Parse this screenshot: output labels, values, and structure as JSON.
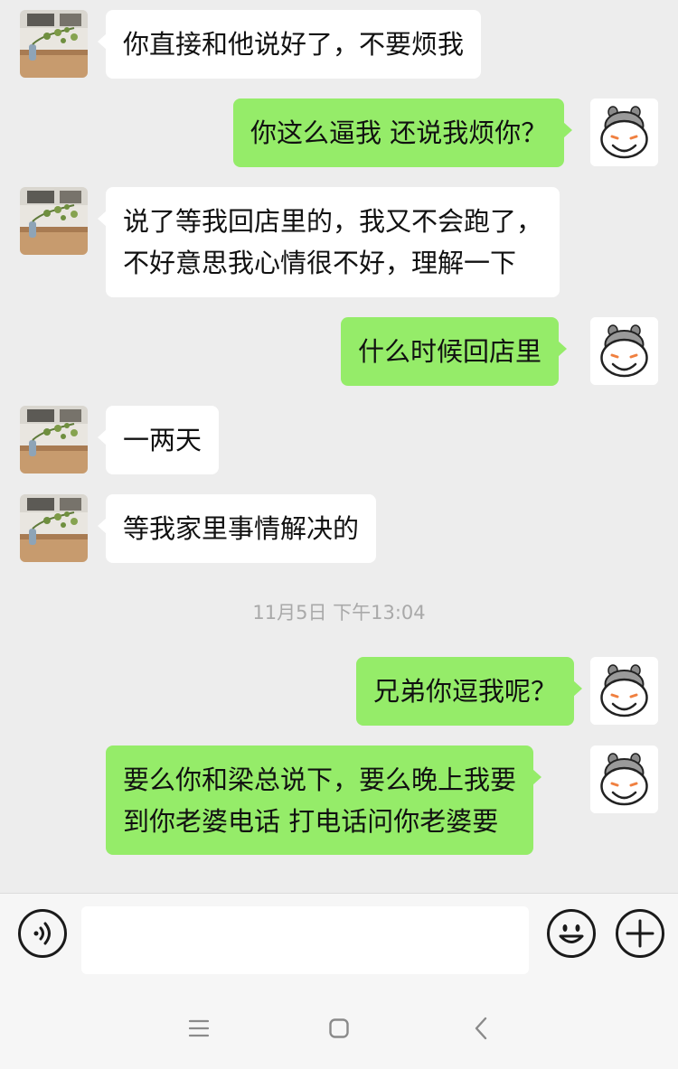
{
  "messages": [
    {
      "side": "in",
      "lines": [
        "你直接和他说好了，不要烦我"
      ]
    },
    {
      "side": "out",
      "lines": [
        "你这么逼我 还说我烦你？"
      ]
    },
    {
      "side": "in",
      "lines": [
        "说了等我回店里的，我又不会跑了，",
        "不好意思我心情很不好，理解一下"
      ]
    },
    {
      "side": "out",
      "lines": [
        "什么时候回店里"
      ]
    },
    {
      "side": "in",
      "lines": [
        "一两天"
      ]
    },
    {
      "side": "in",
      "lines": [
        "等我家里事情解决的"
      ]
    },
    {
      "side": "out",
      "lines": [
        "兄弟你逗我呢？"
      ]
    },
    {
      "side": "out",
      "lines": [
        "要么你和梁总说下，要么晚上我要",
        "到你老婆电话 打电话问你老婆要"
      ]
    }
  ],
  "timestamp": "11月5日 下午13:04",
  "input_bar": {
    "voice_icon": "voice-icon",
    "emoji_icon": "emoji-icon",
    "add_icon": "plus-icon",
    "text_value": ""
  },
  "nav_bar": {
    "menu_icon": "menu-icon",
    "home_icon": "home-icon",
    "back_icon": "back-icon"
  },
  "colors": {
    "background": "#ededed",
    "outgoing_bubble": "#95ec69",
    "incoming_bubble": "#ffffff"
  }
}
